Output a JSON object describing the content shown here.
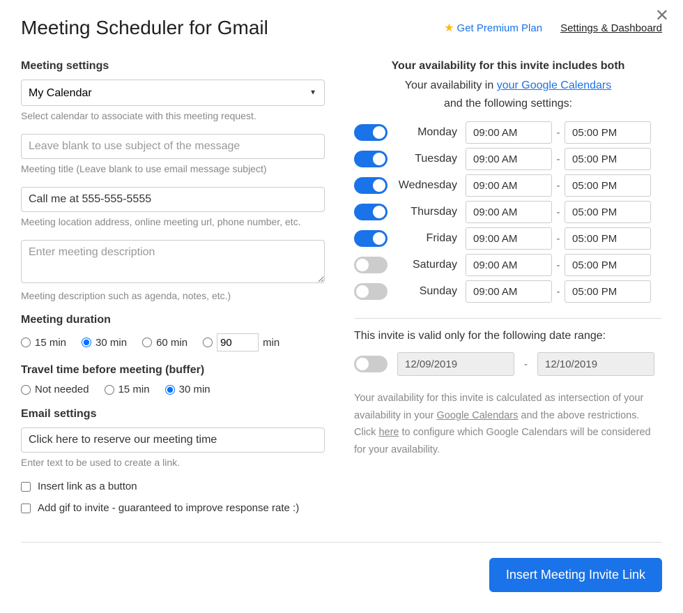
{
  "header": {
    "title": "Meeting Scheduler for Gmail",
    "premium_link": "Get Premium Plan",
    "settings_link": "Settings & Dashboard"
  },
  "left": {
    "meeting_settings_heading": "Meeting settings",
    "calendar_selected": "My Calendar",
    "calendar_helper": "Select calendar to associate with this meeting request.",
    "title_placeholder": "Leave blank to use subject of the message",
    "title_helper": "Meeting title (Leave blank to use email message subject)",
    "location_value": "Call me at 555-555-5555",
    "location_helper": "Meeting location address, online meeting url, phone number, etc.",
    "description_placeholder": "Enter meeting description",
    "description_helper": "Meeting description such as agenda, notes, etc.)",
    "duration_heading": "Meeting duration",
    "dur_15": "15 min",
    "dur_30": "30 min",
    "dur_60": "60 min",
    "dur_custom_value": "90",
    "dur_custom_unit": "min",
    "buffer_heading": "Travel time before meeting (buffer)",
    "buf_none": "Not needed",
    "buf_15": "15 min",
    "buf_30": "30 min",
    "email_heading": "Email settings",
    "link_text_value": "Click here to reserve our meeting time",
    "link_text_helper": "Enter text to be used to create a link.",
    "cb_button": "Insert link as a button",
    "cb_gif": "Add gif to invite - guaranteed to improve response rate :)"
  },
  "right": {
    "avail_heading": "Your availability for this invite includes both",
    "avail_sub_prefix": "Your availability in ",
    "avail_link": "your Google Calendars",
    "avail_sub2": "and the following settings:",
    "days": [
      {
        "name": "Monday",
        "on": true,
        "start": "09:00 AM",
        "end": "05:00 PM"
      },
      {
        "name": "Tuesday",
        "on": true,
        "start": "09:00 AM",
        "end": "05:00 PM"
      },
      {
        "name": "Wednesday",
        "on": true,
        "start": "09:00 AM",
        "end": "05:00 PM"
      },
      {
        "name": "Thursday",
        "on": true,
        "start": "09:00 AM",
        "end": "05:00 PM"
      },
      {
        "name": "Friday",
        "on": true,
        "start": "09:00 AM",
        "end": "05:00 PM"
      },
      {
        "name": "Saturday",
        "on": false,
        "start": "09:00 AM",
        "end": "05:00 PM"
      },
      {
        "name": "Sunday",
        "on": false,
        "start": "09:00 AM",
        "end": "05:00 PM"
      }
    ],
    "date_range_heading": "This invite is valid only for the following date range:",
    "date_range_on": false,
    "date_start": "12/09/2019",
    "date_end": "12/10/2019",
    "footer_note_1": "Your availability for this invite is calculated as intersection of your availability in your ",
    "footer_link_1": "Google Calendars",
    "footer_note_2": " and the above restrictions. Click ",
    "footer_link_2": "here",
    "footer_note_3": " to configure which Google Calendars will be considered for your availability."
  },
  "footer": {
    "insert_button": "Insert Meeting Invite Link"
  }
}
